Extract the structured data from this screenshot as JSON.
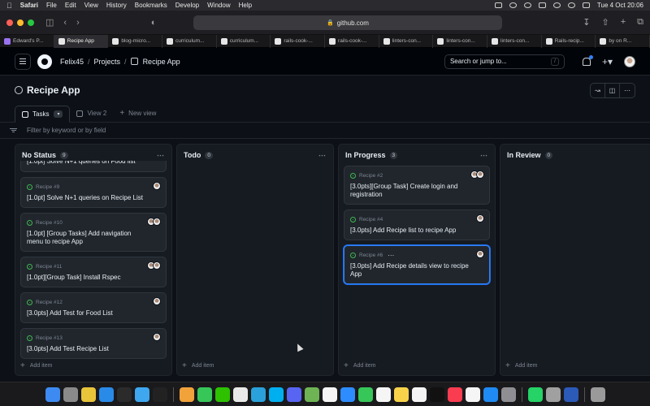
{
  "menubar": {
    "app": "Safari",
    "items": [
      "File",
      "Edit",
      "View",
      "History",
      "Bookmarks",
      "Develop",
      "Window",
      "Help"
    ],
    "datetime": "Tue 4 Oct  20:06"
  },
  "safari": {
    "url": "github.com"
  },
  "browser_tabs": [
    {
      "label": "Edward's P..."
    },
    {
      "label": "Recipe App",
      "active": true
    },
    {
      "label": "blog-micro..."
    },
    {
      "label": "curriculum..."
    },
    {
      "label": "curriculum..."
    },
    {
      "label": "rails-cook-..."
    },
    {
      "label": "rails-cook-..."
    },
    {
      "label": "linters-con..."
    },
    {
      "label": "linters-con..."
    },
    {
      "label": "linters-con..."
    },
    {
      "label": "Rails-recip..."
    },
    {
      "label": "by on R..."
    }
  ],
  "header": {
    "user": "Felix45",
    "projects": "Projects",
    "project": "Recipe App",
    "search_placeholder": "Search or jump to...",
    "search_shortcut": "/"
  },
  "project": {
    "title": "Recipe App"
  },
  "views": [
    {
      "label": "Tasks"
    },
    {
      "label": "View 2"
    },
    {
      "label": "New view"
    }
  ],
  "filter": {
    "placeholder": "Filter by keyword or by field"
  },
  "columns": [
    {
      "name": "No Status",
      "count": "9",
      "clipped_card": "[1.0pt] Solve N+1 queries on Food list",
      "cards": [
        {
          "ref": "Recipe #9",
          "title": "[1.0pt] Solve N+1 queries on Recipe List",
          "avatars": 1
        },
        {
          "ref": "Recipe #10",
          "title": "[1.0pt] [Group Tasks] Add navigation menu to recipe App",
          "avatars": 2
        },
        {
          "ref": "Recipe #11",
          "title": "[1.0pt][Group Task] Install Rspec",
          "avatars": 2
        },
        {
          "ref": "Recipe #12",
          "title": "[3.0pts] Add Test for Food List",
          "avatars": 1
        },
        {
          "ref": "Recipe #13",
          "title": "[3.0pts] Add Test Recipe List",
          "avatars": 1
        }
      ]
    },
    {
      "name": "Todo",
      "count": "0",
      "cards": []
    },
    {
      "name": "In Progress",
      "count": "3",
      "cards": [
        {
          "ref": "Recipe #2",
          "title": "[3.0pts][Group Task] Create login and registration",
          "avatars": 2
        },
        {
          "ref": "Recipe #4",
          "title": "[3.0pts] Add Recipe list to recipe App",
          "avatars": 1
        },
        {
          "ref": "Recipe #6",
          "title": "[3.0pts] Add Recipe details view to recipe App",
          "avatars": 1,
          "selected": true
        }
      ]
    },
    {
      "name": "In Review",
      "count": "0",
      "cards": []
    }
  ],
  "add_item_label": "Add item",
  "colors": {
    "bg": "#0d1117",
    "column": "#161b22",
    "card": "#21262d",
    "accent": "#2f81f7",
    "status_open": "#3fb950"
  }
}
